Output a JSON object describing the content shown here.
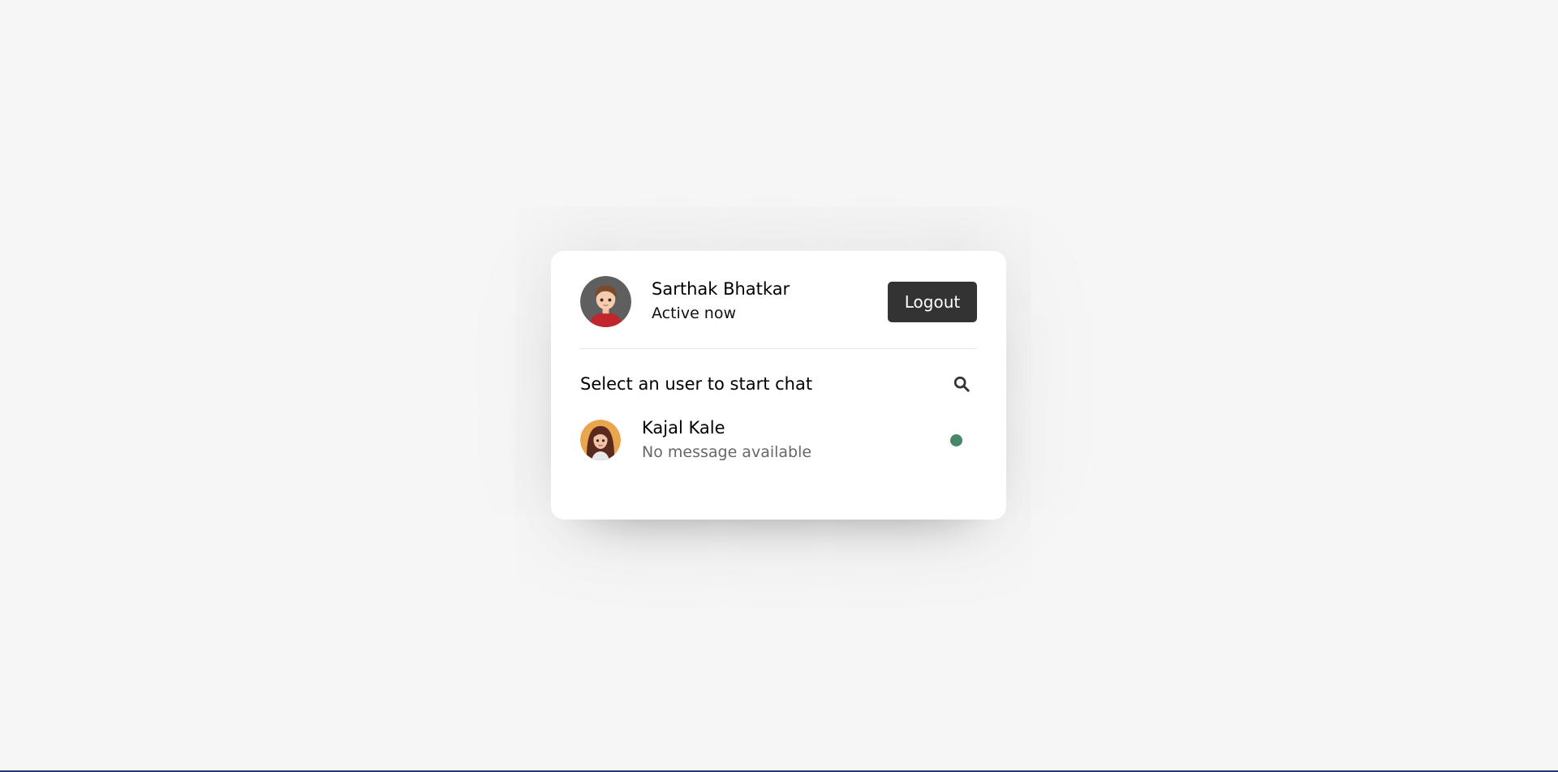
{
  "profile": {
    "name": "Sarthak Bhatkar",
    "status": "Active now",
    "avatar": "boy-avatar",
    "logout_label": "Logout"
  },
  "search": {
    "text": "Select an user to start chat",
    "icon": "search-icon"
  },
  "users": [
    {
      "name": "Kajal Kale",
      "message": "No message available",
      "avatar": "girl-avatar",
      "status": "online"
    }
  ],
  "colors": {
    "background": "#f6f6f6",
    "card": "#ffffff",
    "button": "#333333",
    "online": "#468669",
    "bottom_bar": "#1f3f6e"
  }
}
